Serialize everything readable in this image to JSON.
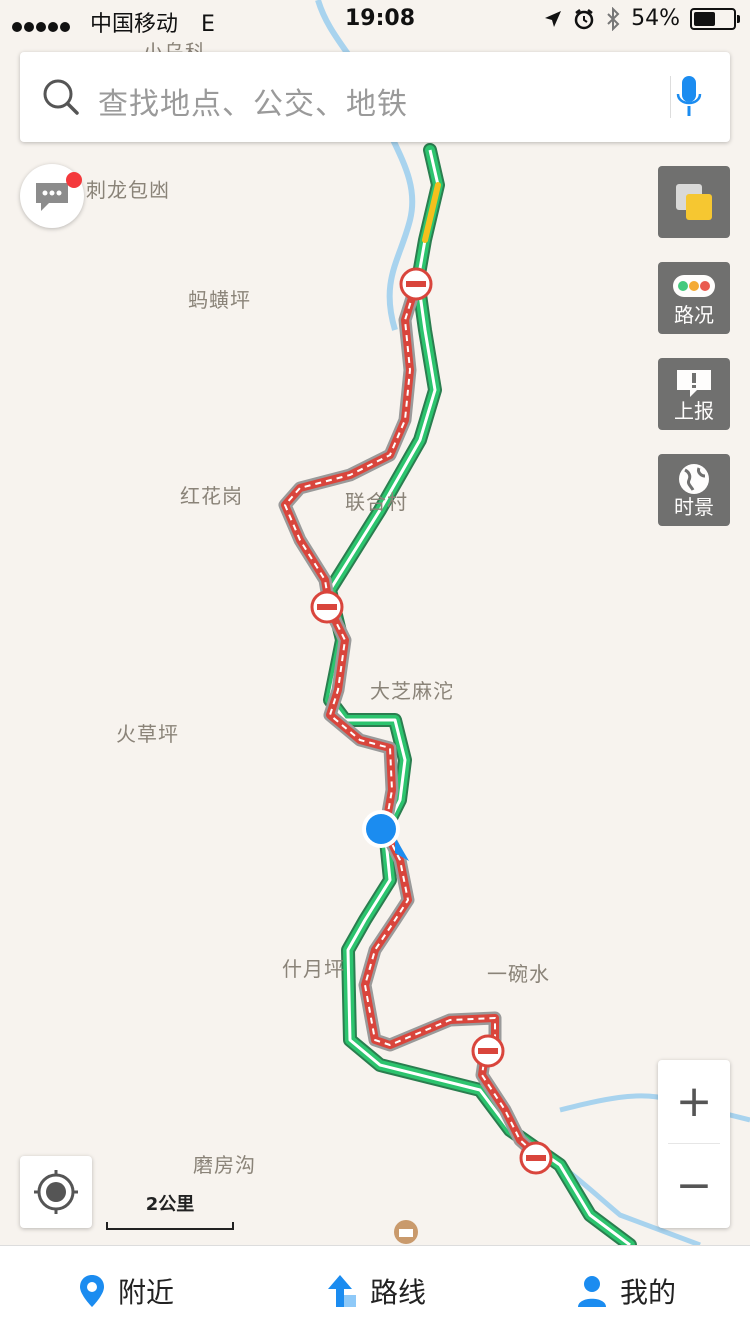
{
  "status_bar": {
    "carrier": "中国移动",
    "network": "E",
    "time": "19:08",
    "battery": "54%",
    "battery_level": 0.54
  },
  "search": {
    "placeholder": "查找地点、公交、地铁"
  },
  "map": {
    "places": [
      {
        "id": "xiaowuke",
        "text": "小乌科"
      },
      {
        "id": "cilongbaoyou",
        "text": "刺龙包凼"
      },
      {
        "id": "mahuangping",
        "text": "蚂蟥坪"
      },
      {
        "id": "honghuagang",
        "text": "红花岗"
      },
      {
        "id": "lianhecun",
        "text": "联合村"
      },
      {
        "id": "dazhimatuo",
        "text": "大芝麻沱"
      },
      {
        "id": "huocaoping",
        "text": "火草坪"
      },
      {
        "id": "shiyueping",
        "text": "什月坪"
      },
      {
        "id": "yiwanshui",
        "text": "一碗水"
      },
      {
        "id": "mofanggou",
        "text": "磨房沟"
      }
    ],
    "scale": "2公里"
  },
  "side_buttons": {
    "layers_icon": "layers-icon",
    "traffic_label": "路况",
    "report_label": "上报",
    "timeview_label": "时景"
  },
  "zoom": {
    "in": "+",
    "out": "−"
  },
  "colors": {
    "route_green": "#2cc46e",
    "route_closed": "#d9453c",
    "river": "#a8d3ee",
    "accent": "#1b8cf0",
    "map_bg": "#f7f3ee"
  },
  "tabbar": {
    "nearby_label": "附近",
    "route_label": "路线",
    "mine_label": "我的"
  }
}
